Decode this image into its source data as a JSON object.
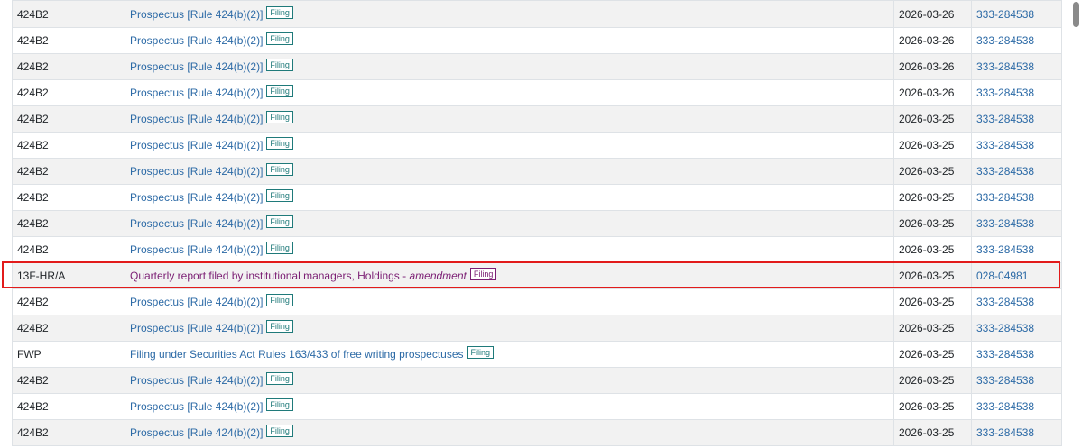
{
  "rows": [
    {
      "type": "424B2",
      "desc": "Prospectus [Rule 424(b)(2)]",
      "badge": "Filing",
      "date": "2026-03-26",
      "file": "333-284538"
    },
    {
      "type": "424B2",
      "desc": "Prospectus [Rule 424(b)(2)]",
      "badge": "Filing",
      "date": "2026-03-26",
      "file": "333-284538"
    },
    {
      "type": "424B2",
      "desc": "Prospectus [Rule 424(b)(2)]",
      "badge": "Filing",
      "date": "2026-03-26",
      "file": "333-284538"
    },
    {
      "type": "424B2",
      "desc": "Prospectus [Rule 424(b)(2)]",
      "badge": "Filing",
      "date": "2026-03-26",
      "file": "333-284538"
    },
    {
      "type": "424B2",
      "desc": "Prospectus [Rule 424(b)(2)]",
      "badge": "Filing",
      "date": "2026-03-25",
      "file": "333-284538"
    },
    {
      "type": "424B2",
      "desc": "Prospectus [Rule 424(b)(2)]",
      "badge": "Filing",
      "date": "2026-03-25",
      "file": "333-284538"
    },
    {
      "type": "424B2",
      "desc": "Prospectus [Rule 424(b)(2)]",
      "badge": "Filing",
      "date": "2026-03-25",
      "file": "333-284538"
    },
    {
      "type": "424B2",
      "desc": "Prospectus [Rule 424(b)(2)]",
      "badge": "Filing",
      "date": "2026-03-25",
      "file": "333-284538"
    },
    {
      "type": "424B2",
      "desc": "Prospectus [Rule 424(b)(2)]",
      "badge": "Filing",
      "date": "2026-03-25",
      "file": "333-284538"
    },
    {
      "type": "424B2",
      "desc": "Prospectus [Rule 424(b)(2)]",
      "badge": "Filing",
      "date": "2026-03-25",
      "file": "333-284538"
    },
    {
      "type": "13F-HR/A",
      "desc": "Quarterly report filed by institutional managers, Holdings - ",
      "desc_em": "amendment",
      "badge": "Filing",
      "date": "2026-03-25",
      "file": "028-04981",
      "visited": true,
      "highlighted": true
    },
    {
      "type": "424B2",
      "desc": "Prospectus [Rule 424(b)(2)]",
      "badge": "Filing",
      "date": "2026-03-25",
      "file": "333-284538"
    },
    {
      "type": "424B2",
      "desc": "Prospectus [Rule 424(b)(2)]",
      "badge": "Filing",
      "date": "2026-03-25",
      "file": "333-284538"
    },
    {
      "type": "FWP",
      "desc": "Filing under Securities Act Rules 163/433 of free writing prospectuses",
      "badge": "Filing",
      "date": "2026-03-25",
      "file": "333-284538"
    },
    {
      "type": "424B2",
      "desc": "Prospectus [Rule 424(b)(2)]",
      "badge": "Filing",
      "date": "2026-03-25",
      "file": "333-284538"
    },
    {
      "type": "424B2",
      "desc": "Prospectus [Rule 424(b)(2)]",
      "badge": "Filing",
      "date": "2026-03-25",
      "file": "333-284538"
    },
    {
      "type": "424B2",
      "desc": "Prospectus [Rule 424(b)(2)]",
      "badge": "Filing",
      "date": "2026-03-25",
      "file": "333-284538"
    }
  ],
  "colors": {
    "link": "#2c6aa6",
    "visited": "#7b1f74",
    "badge": "#1f7a7a",
    "highlight": "#e21b1b"
  }
}
